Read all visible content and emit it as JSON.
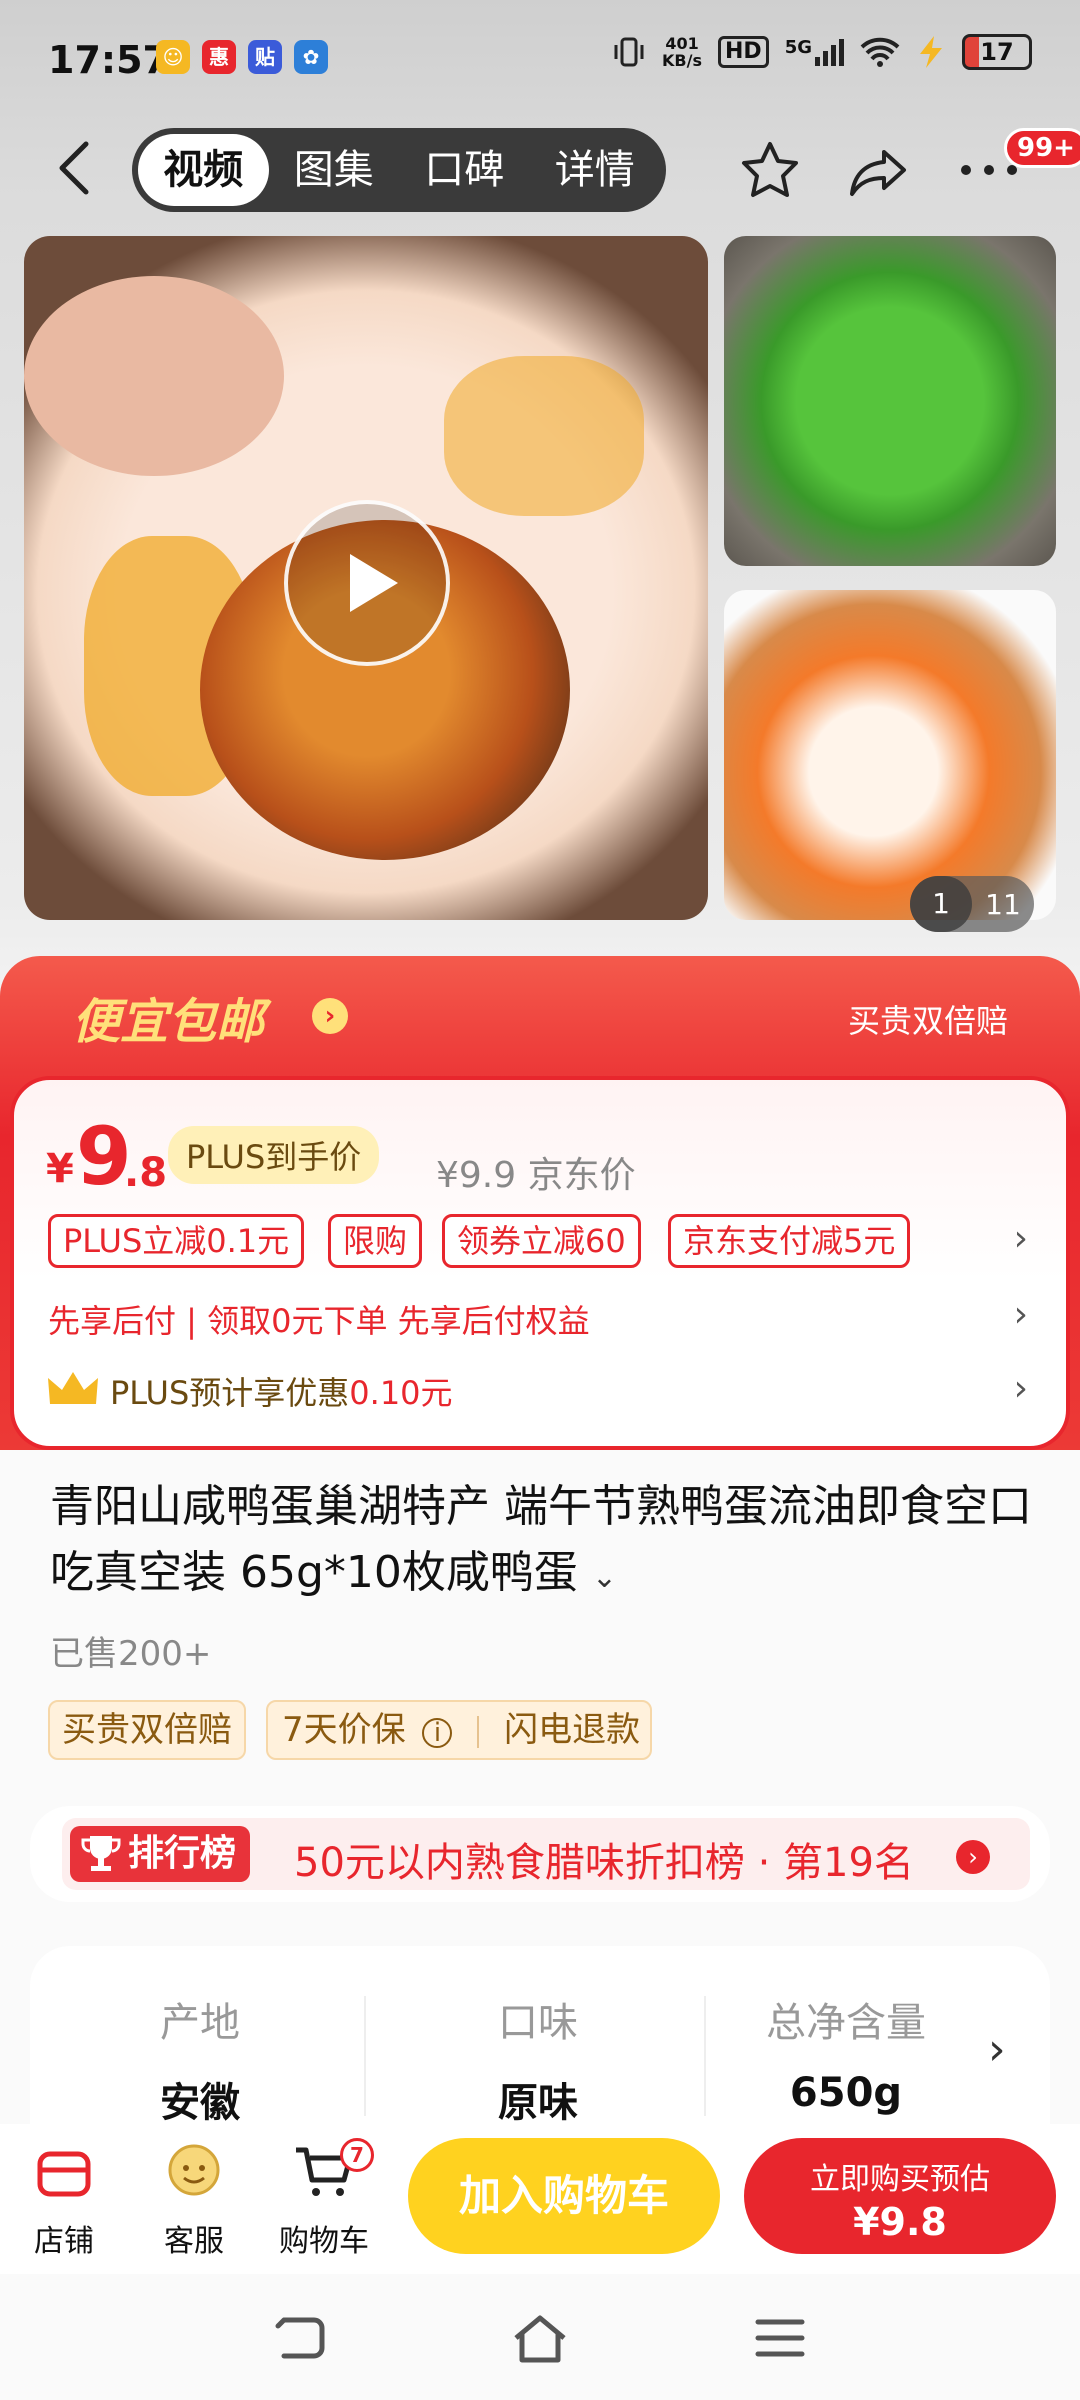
{
  "status_bar": {
    "time": "17:57",
    "net_speed_value": "401",
    "net_speed_unit": "KB/s",
    "hd": "HD",
    "signal": "5G",
    "battery": "17"
  },
  "nav": {
    "tabs": [
      {
        "label": "视频",
        "active": true
      },
      {
        "label": "图集",
        "active": false
      },
      {
        "label": "口碑",
        "active": false
      },
      {
        "label": "详情",
        "active": false
      }
    ],
    "more_badge": "99+"
  },
  "gallery": {
    "current": "1",
    "total": "11"
  },
  "promo": {
    "title": "便宜包邮",
    "right_text": "买贵双倍赔"
  },
  "price": {
    "currency": "¥",
    "integer": "9",
    "decimal": ".8",
    "plus_tag": "PLUS到手价",
    "original": "¥9.9 京东价",
    "chips": [
      "PLUS立减0.1元",
      "限购",
      "领券立减60",
      "京东支付减5元"
    ],
    "row2": "先享后付 | 领取0元下单 先享后付权益",
    "row3_prefix": "PLUS预计享优惠",
    "row3_amount": "0.10元"
  },
  "product": {
    "title": "青阳山咸鸭蛋巢湖特产 端午节熟鸭蛋流油即食空口吃真空装 65g*10枚咸鸭蛋",
    "sold": "已售200+",
    "tags": [
      "买贵双倍赔",
      "7天价保",
      "闪电退款"
    ]
  },
  "ranking": {
    "badge": "排行榜",
    "text": "50元以内熟食腊味折扣榜 · 第19名"
  },
  "specs": [
    {
      "key": "产地",
      "value": "安徽"
    },
    {
      "key": "口味",
      "value": "原味"
    },
    {
      "key": "总净含量",
      "value": "650g"
    }
  ],
  "bottom_bar": {
    "store": "店铺",
    "service": "客服",
    "cart": "购物车",
    "cart_count": "7",
    "add_cart": "加入购物车",
    "buy_line1": "立即购买预估",
    "buy_line2": "¥9.8"
  },
  "colors": {
    "accent_red": "#e8262d",
    "yellow_button": "#ffd21f",
    "promo_title": "#ffe07a"
  }
}
